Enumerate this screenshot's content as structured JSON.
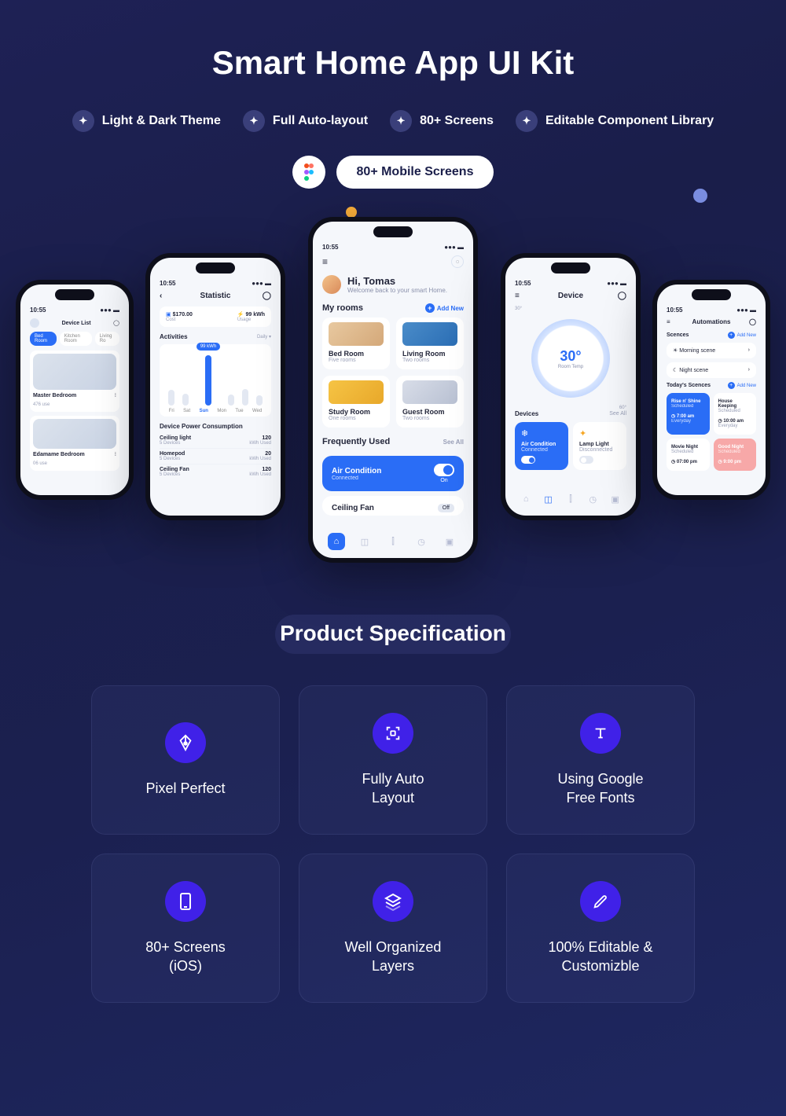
{
  "hero": {
    "title": "Smart Home App UI Kit"
  },
  "features": [
    "Light & Dark Theme",
    "Full Auto-layout",
    "80+ Screens",
    "Editable Component Library"
  ],
  "pill": "80+ Mobile Screens",
  "phones": {
    "time": "10:55",
    "deviceList": {
      "title": "Device List",
      "tabs": [
        "Bed Room",
        "Kitchen Room",
        "Living Ro"
      ],
      "rooms": [
        {
          "name": "Master Bedroom",
          "sub": "476 use"
        },
        {
          "name": "Edamame Bedroom",
          "sub": "06 use"
        }
      ]
    },
    "statistic": {
      "title": "Statistic",
      "tiles": {
        "cost": {
          "value": "$170.00",
          "label": "Cost"
        },
        "usage": {
          "value": "99 kWh",
          "label": "Usage"
        }
      },
      "activities": {
        "label": "Activities",
        "dropdown": "Daily",
        "badge": "99 kWh",
        "days": [
          "Fri",
          "Sat",
          "Sun",
          "Mon",
          "Tue",
          "Wed"
        ]
      },
      "power": {
        "label": "Device Power Consumption",
        "rows": [
          {
            "n": "Ceiling light",
            "s": "5 Devices",
            "v": "120",
            "u": "kWh Used"
          },
          {
            "n": "Homepod",
            "s": "5 Devices",
            "v": "20",
            "u": "kWh Used"
          },
          {
            "n": "Ceiling Fan",
            "s": "5 Devices",
            "v": "120",
            "u": "kWh Used"
          }
        ]
      }
    },
    "home": {
      "greet": "Hi, Tomas",
      "sub": "Welcome back to your smart Home.",
      "rooms": {
        "label": "My rooms",
        "add": "Add New",
        "items": [
          {
            "n": "Bed Room",
            "s": "Five rooms"
          },
          {
            "n": "Living Room",
            "s": "Two rooms"
          },
          {
            "n": "Study Room",
            "s": "One rooms"
          },
          {
            "n": "Guest Room",
            "s": "Two rooms"
          }
        ]
      },
      "freq": {
        "label": "Frequently Used",
        "see": "See All",
        "items": [
          {
            "n": "Air Condition",
            "s": "Connected",
            "st": "On"
          },
          {
            "n": "Ceiling Fan",
            "s": "",
            "st": "Off"
          }
        ]
      }
    },
    "device": {
      "title": "Device",
      "temp": {
        "value": "30°",
        "label": "Room Temp",
        "lo": "30°",
        "hi": "60°"
      },
      "section": {
        "label": "Devices",
        "see": "See All"
      },
      "items": [
        {
          "n": "Air Condition",
          "s": "Connected",
          "on": true
        },
        {
          "n": "Lamp Light",
          "s": "Disconnected",
          "on": false
        }
      ]
    },
    "auto": {
      "title": "Automations",
      "scences": {
        "label": "Scences",
        "add": "Add New",
        "items": [
          "Morning scene",
          "Night scene"
        ]
      },
      "today": {
        "label": "Today's Scences",
        "add": "Add New",
        "items": [
          {
            "n": "Rise n' Shine",
            "s": "Scheduled",
            "t": "7:00 am",
            "d": "Everyday"
          },
          {
            "n": "House Keeping",
            "s": "Scheduled",
            "t": "10:00 am",
            "d": "Everyday"
          },
          {
            "n": "Movie Night",
            "s": "Scheduled",
            "t": "07:00 pm",
            "d": ""
          },
          {
            "n": "Good Night",
            "s": "Scheduled",
            "t": "9:00 pm",
            "d": ""
          }
        ]
      }
    }
  },
  "spec": {
    "title": "Product Specification",
    "cards": [
      {
        "icon": "pen",
        "label": "Pixel Perfect"
      },
      {
        "icon": "frame",
        "label": "Fully Auto\nLayout"
      },
      {
        "icon": "type",
        "label": "Using Google\nFree Fonts"
      },
      {
        "icon": "mobile",
        "label": "80+ Screens\n(iOS)"
      },
      {
        "icon": "layers",
        "label": "Well Organized\nLayers"
      },
      {
        "icon": "pencil",
        "label": "100% Editable &\nCustomizble"
      }
    ]
  }
}
